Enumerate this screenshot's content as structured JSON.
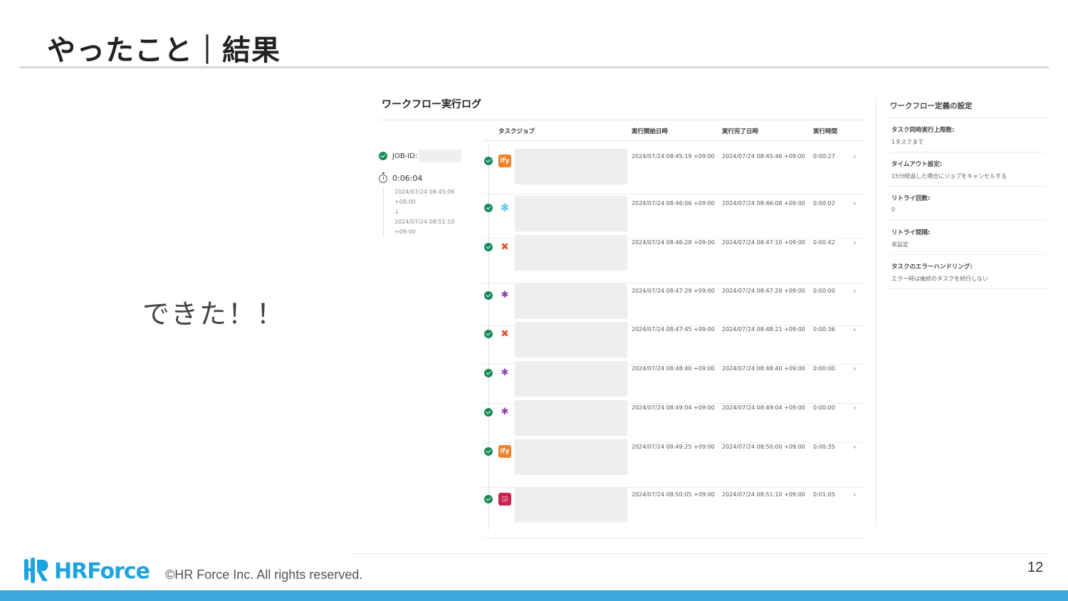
{
  "slide": {
    "title": "やったこと｜結果",
    "message": "できた！！",
    "page_number": "12",
    "copyright": "©HR Force Inc. All rights reserved.",
    "logo_text": "HRForce",
    "colors": {
      "accent": "#3aa7dc",
      "logo": "#1fa3dd",
      "success": "#1a8a5a"
    }
  },
  "workflow_log": {
    "title": "ワークフロー実行ログ",
    "job_label": "JOB-ID:",
    "duration": "0:06:04",
    "start": "2024/07/24 08:45:06",
    "start_tz": "+09:00",
    "arrow": "↓",
    "end": "2024/07/24 08:51:10",
    "end_tz": "+09:00",
    "columns": {
      "task": "タスクジョブ",
      "start": "実行開始日時",
      "end": "実行完了日時",
      "time": "実行時間"
    },
    "rows": [
      {
        "icon": "orange-app-icon",
        "start": "2024/07/24 08:45:19 +09:00",
        "end": "2024/07/24 08:45:46 +09:00",
        "time": "0:00:27"
      },
      {
        "icon": "snowflake-icon",
        "start": "2024/07/24 08:46:06 +09:00",
        "end": "2024/07/24 08:46:08 +09:00",
        "time": "0:00:02"
      },
      {
        "icon": "x-app-icon",
        "start": "2024/07/24 08:46:28 +09:00",
        "end": "2024/07/24 08:47:10 +09:00",
        "time": "0:00:42"
      },
      {
        "icon": "slack-icon",
        "start": "2024/07/24 08:47:29 +09:00",
        "end": "2024/07/24 08:47:29 +09:00",
        "time": "0:00:00"
      },
      {
        "icon": "x-app-icon",
        "start": "2024/07/24 08:47:45 +09:00",
        "end": "2024/07/24 08:48:21 +09:00",
        "time": "0:00:36"
      },
      {
        "icon": "slack-icon",
        "start": "2024/07/24 08:48:40 +09:00",
        "end": "2024/07/24 08:48:40 +09:00",
        "time": "0:00:00"
      },
      {
        "icon": "slack-icon",
        "start": "2024/07/24 08:49:04 +09:00",
        "end": "2024/07/24 08:49:04 +09:00",
        "time": "0:00:00"
      },
      {
        "icon": "orange-app-icon",
        "start": "2024/07/24 08:49:25 +09:00",
        "end": "2024/07/24 08:50:00 +09:00",
        "time": "0:00:35"
      },
      {
        "icon": "red-app-icon",
        "start": "2024/07/24 08:50:05 +09:00",
        "end": "2024/07/24 08:51:10 +09:00",
        "time": "0:01:05"
      }
    ]
  },
  "settings": {
    "title": "ワークフロー定義の設定",
    "items": [
      {
        "label": "タスク同時実行上限数:",
        "value": "1タスクまで"
      },
      {
        "label": "タイムアウト設定:",
        "value": "15分経過した場合にジョブをキャンセルする"
      },
      {
        "label": "リトライ回数:",
        "value": "0"
      },
      {
        "label": "リトライ間隔:",
        "value": "未設定"
      },
      {
        "label": "タスクのエラーハンドリング:",
        "value": "エラー時は後続のタスクを続行しない"
      }
    ]
  }
}
